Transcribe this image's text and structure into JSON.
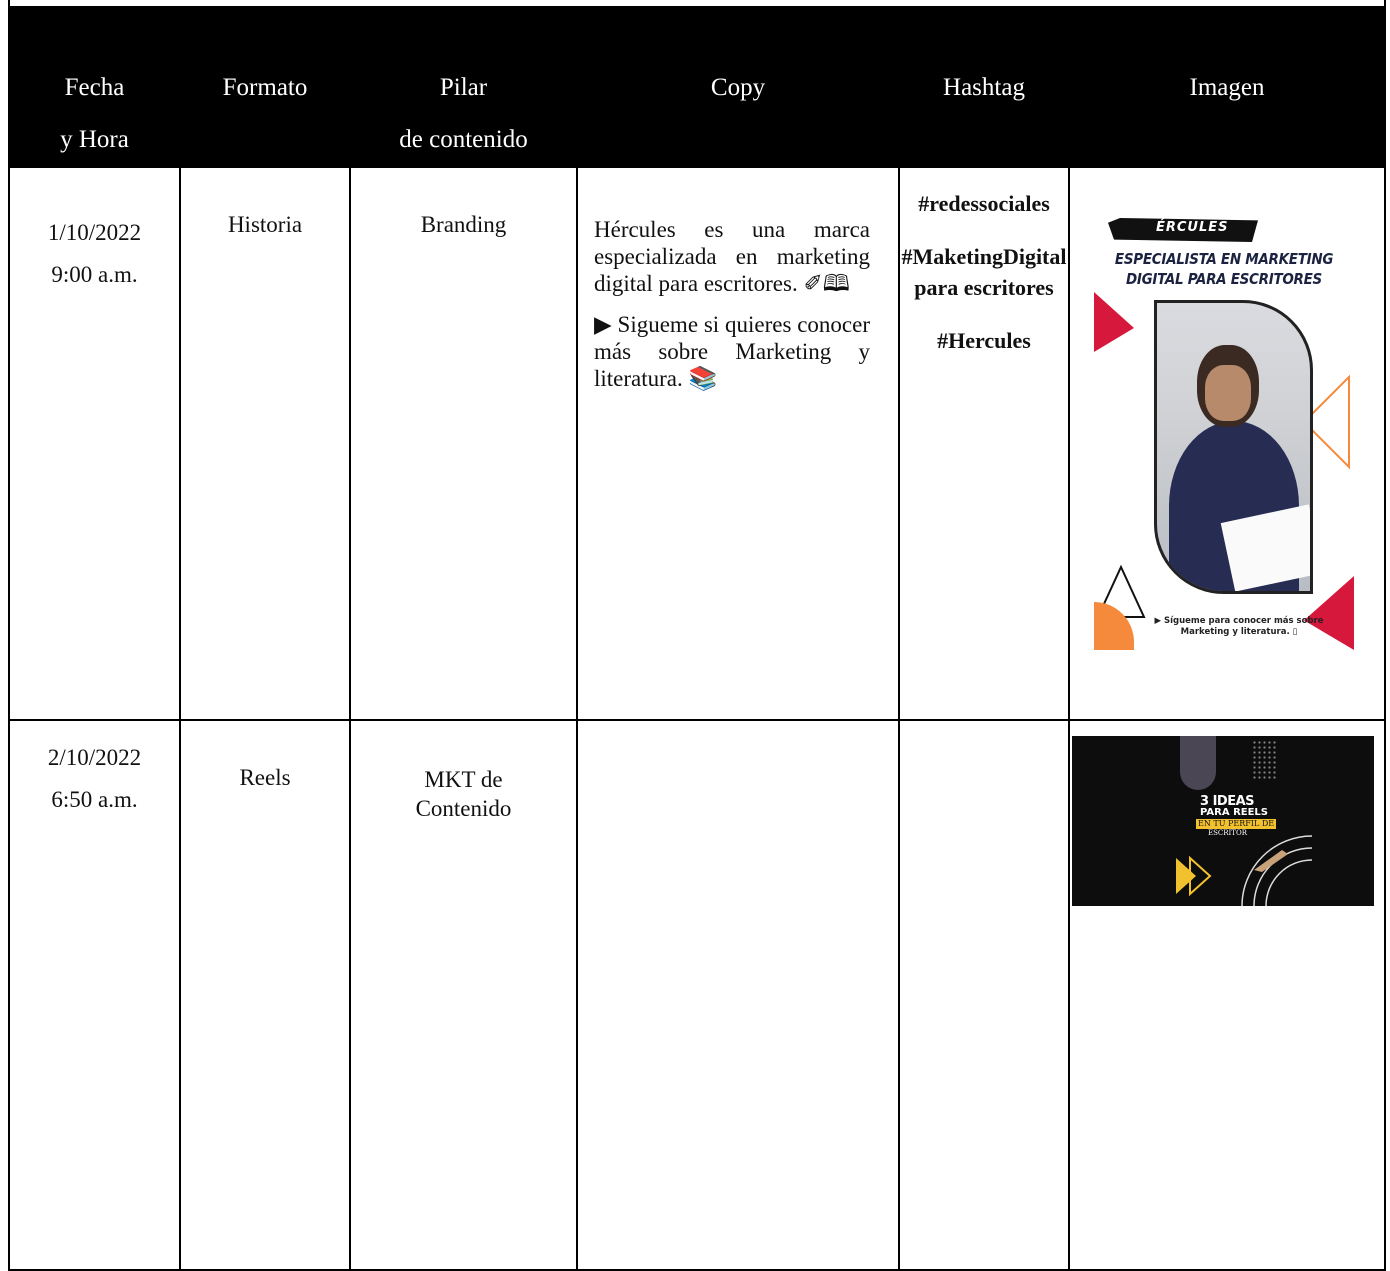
{
  "header": {
    "fecha": [
      "Fecha",
      "y Hora"
    ],
    "formato": "Formato",
    "pilar": [
      "Pilar",
      "de contenido"
    ],
    "copy": "Copy",
    "hashtag": "Hashtag",
    "imagen": "Imagen"
  },
  "rows": [
    {
      "fecha": "1/10/2022",
      "hora": "9:00 a.m.",
      "formato": "Historia",
      "pilar": "Branding",
      "copy_p1": "Hércules es una marca especializada en marketing digital para escritores. ✐🕮",
      "copy_p2": "▶ Sigueme si quieres conocer más sobre Marketing y literatura. 📚",
      "hashtags": [
        "#redessociales",
        "#MaketingDigitalpara escritores",
        "#Hercules"
      ],
      "image": {
        "brand": "ÉRCULES",
        "headline1": "ESPECIALISTA EN MARKETING",
        "headline2": "DIGITAL PARA ESCRITORES",
        "caption": "▶ Sígueme para conocer más sobre Marketing y literatura. ▯"
      }
    },
    {
      "fecha": "2/10/2022",
      "hora": "6:50 a.m.",
      "formato": "Reels",
      "pilar": "MKT de Contenido",
      "copy_p1": "",
      "copy_p2": "",
      "hashtags": [],
      "image": {
        "line1": "3 IDEAS",
        "line2": "PARA REELS",
        "line3": "EN TU PERFIL DE",
        "line4": "ESCRITOR"
      }
    }
  ],
  "colors": {
    "header_bg": "#000000",
    "accent_red": "#d7183d",
    "accent_orange": "#f58a3c",
    "accent_yellow": "#f2c12e"
  }
}
